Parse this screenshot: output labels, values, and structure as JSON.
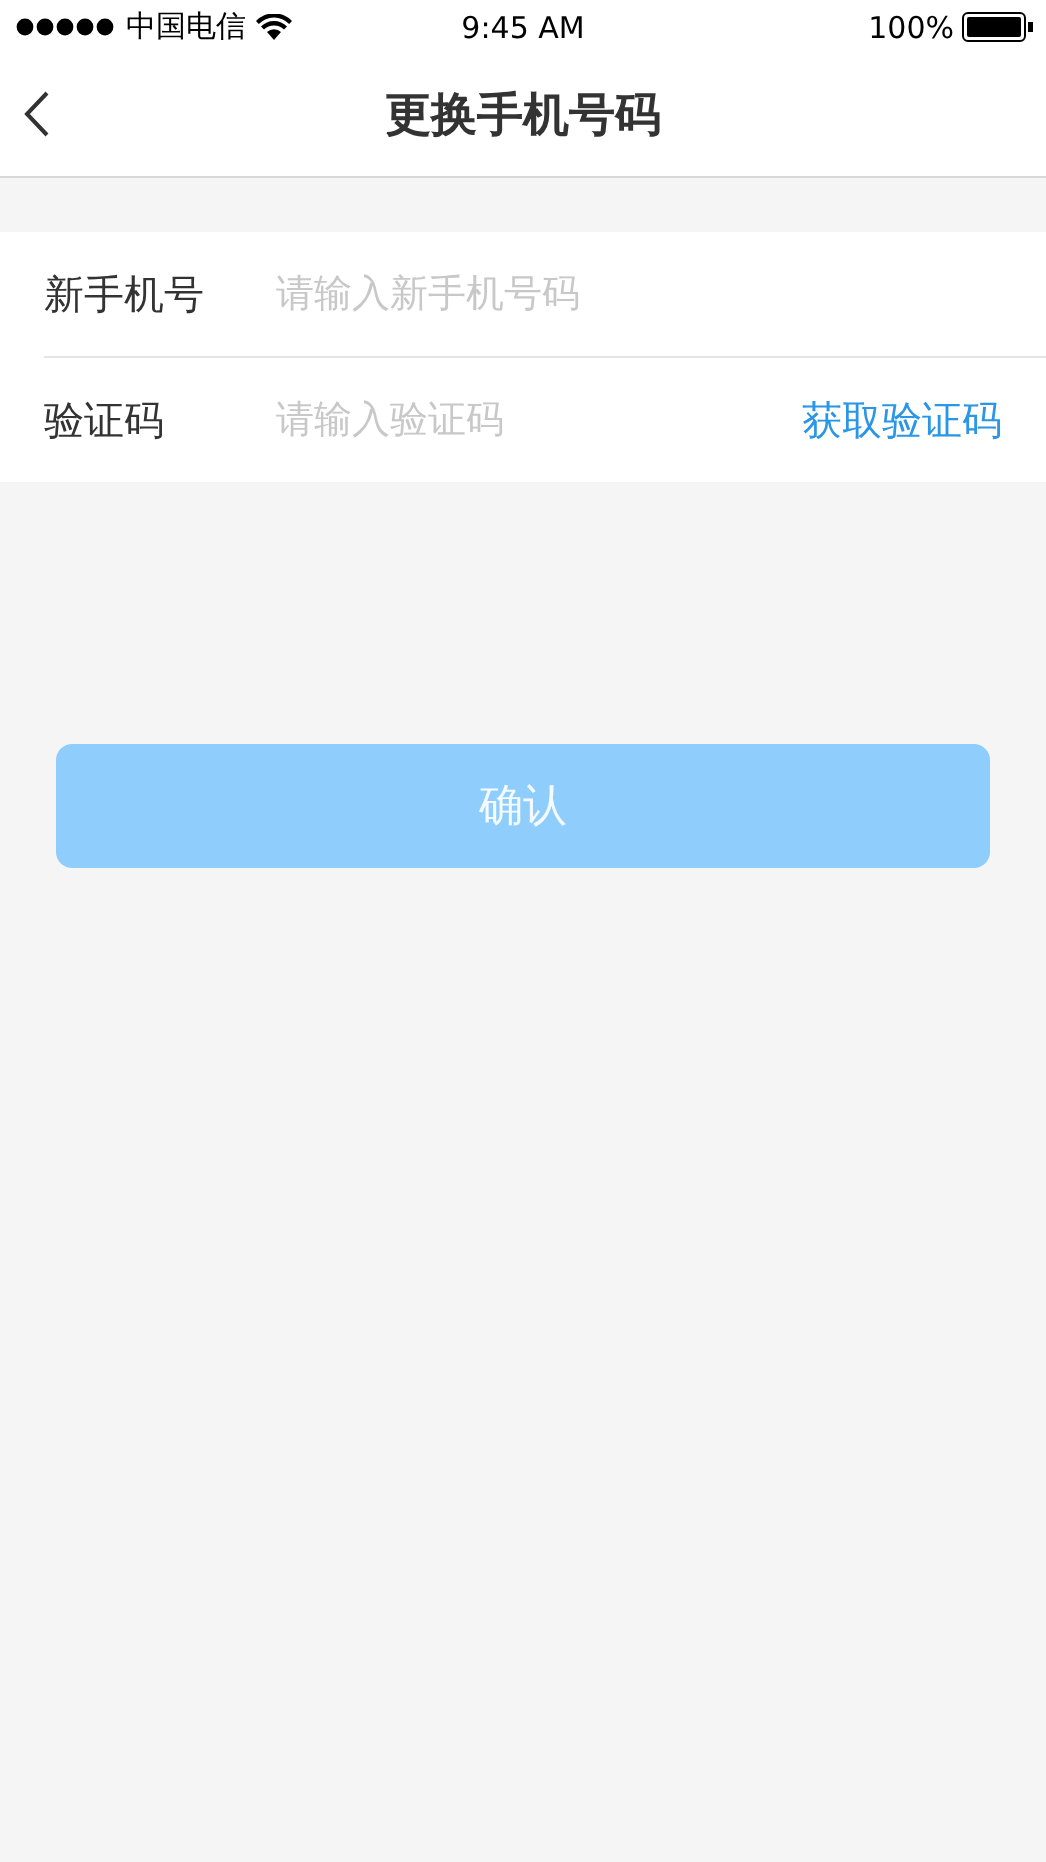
{
  "status_bar": {
    "carrier": "中国电信",
    "time": "9:45 AM",
    "battery": "100%"
  },
  "nav": {
    "title": "更换手机号码"
  },
  "form": {
    "rows": [
      {
        "label": "新手机号",
        "placeholder": "请输入新手机号码"
      },
      {
        "label": "验证码",
        "placeholder": "请输入验证码",
        "action": "获取验证码"
      }
    ]
  },
  "confirm_button": {
    "label": "确认",
    "disabled": true
  }
}
